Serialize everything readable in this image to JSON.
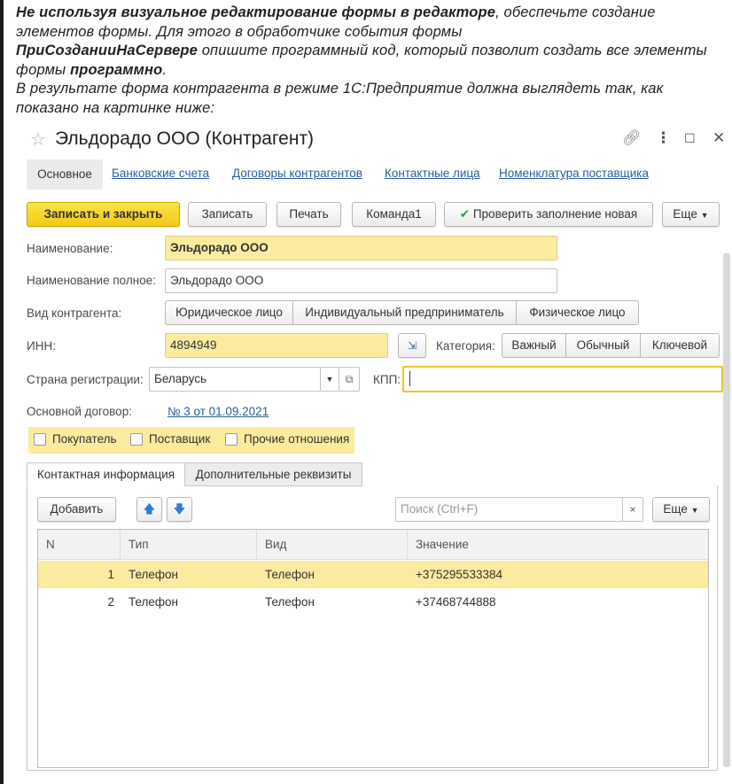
{
  "task": {
    "p1_bold": "Не используя визуальное редактирование формы в редакторе",
    "p1_rest": ", обеспечьте создание элементов формы. Для этого в обработчике события формы",
    "p2_bold": "ПриСозданииНаСервере",
    "p2_rest": " опишите программный код, который позволит создать все элементы формы ",
    "p2_bold2": "программно",
    "p2_end": ".",
    "p3": "В результате форма контрагента в режиме 1С:Предприятие должна выглядеть так, как показано на картинке ниже:"
  },
  "window": {
    "title": "Эльдорадо ООО (Контрагент)",
    "icons": [
      "star-icon",
      "link-icon",
      "more-vertical-icon",
      "maximize-icon",
      "close-icon"
    ]
  },
  "top_tabs": {
    "active": "Основное",
    "links": [
      "Банковские счета",
      "Договоры контрагентов",
      "Контактные лица",
      "Номенклатура поставщика"
    ]
  },
  "toolbar": {
    "save_close": "Записать и закрыть",
    "save": "Записать",
    "print": "Печать",
    "command1": "Команда1",
    "check_fill": "Проверить заполнение новая",
    "more": "Еще"
  },
  "form": {
    "name_label": "Наименование:",
    "name_value": "Эльдорадо ООО",
    "fullname_label": "Наименование полное:",
    "fullname_value": "Эльдорадо ООО",
    "kind_label": "Вид контрагента:",
    "kind_options": [
      "Юридическое лицо",
      "Индивидуальный предприниматель",
      "Физическое лицо"
    ],
    "inn_label": "ИНН:",
    "inn_value": "4894949",
    "category_label": "Категория:",
    "category_options": [
      "Важный",
      "Обычный",
      "Ключевой"
    ],
    "country_label": "Страна регистрации:",
    "country_value": "Беларусь",
    "kpp_label": "КПП:",
    "kpp_value": "",
    "contract_label": "Основной договор:",
    "contract_value": "№ 3 от 01.09.2021",
    "checkboxes": [
      "Покупатель",
      "Поставщик",
      "Прочие отношения"
    ]
  },
  "inner_tabs": [
    "Контактная информация",
    "Дополнительные реквизиты"
  ],
  "table_toolbar": {
    "add": "Добавить",
    "search_placeholder": "Поиск (Ctrl+F)",
    "more": "Еще"
  },
  "table": {
    "columns": [
      "N",
      "Тип",
      "Вид",
      "Значение"
    ],
    "rows": [
      {
        "n": "1",
        "type": "Телефон",
        "kind": "Телефон",
        "value": "+375295533384",
        "selected": true
      },
      {
        "n": "2",
        "type": "Телефон",
        "kind": "Телефон",
        "value": "+37468744888",
        "selected": false
      }
    ]
  },
  "colors": {
    "accent_yellow": "#fbeb9f",
    "primary_button": "#f2ca14",
    "link": "#2a5d9e",
    "check_green": "#2e9e3e"
  }
}
